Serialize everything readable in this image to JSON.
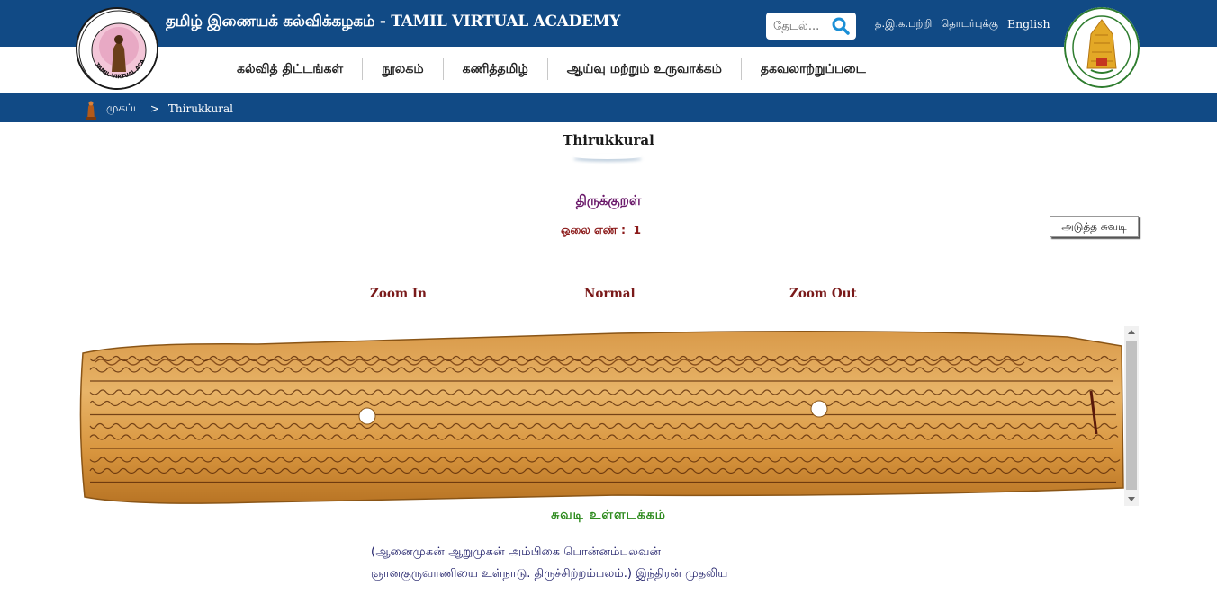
{
  "header": {
    "site_title": "தமிழ் இணையக் கல்விக்கழகம் - TAMIL VIRTUAL ACADEMY",
    "search_placeholder": "தேடல்...",
    "top_links": [
      "த.இ.க.பற்றி",
      "தொடர்புக்கு",
      "English"
    ],
    "logo_left_text": "TAMIL VIRTUAL ACADEMY"
  },
  "nav": {
    "items": [
      "கல்வித் திட்டங்கள்",
      "நூலகம்",
      "கணித்தமிழ்",
      "ஆய்வு மற்றும் உருவாக்கம்",
      "தகவலாற்றுப்படை"
    ]
  },
  "breadcrumb": {
    "home": "முகப்பு",
    "separator": ">",
    "current": "Thirukkural"
  },
  "page": {
    "title": "Thirukkural",
    "kural_heading": "திருக்குறள்",
    "leaf_label": "ஓலை எண் :",
    "leaf_number": "1",
    "next_button": "அடுத்த சுவடி",
    "zoom_in": "Zoom In",
    "zoom_normal": "Normal",
    "zoom_out": "Zoom Out",
    "content_heading": "சுவடி உள்ளடக்கம்",
    "content_line1": "(ஆனைமுகன்   ஆறுமுகன்   அம்பிகை   பொன்னம்பலவன்",
    "content_line2": "ஞானகுருவாணியை உள்நாடு. திருச்சிற்றம்பலம்.) இந்திரன் முதலிய"
  },
  "colors": {
    "header_blue": "#114a85",
    "title_purple": "#6b1a6b",
    "leaf_red": "#8b1a1a",
    "content_green": "#2e8b1e",
    "content_text": "#1a1a66"
  }
}
